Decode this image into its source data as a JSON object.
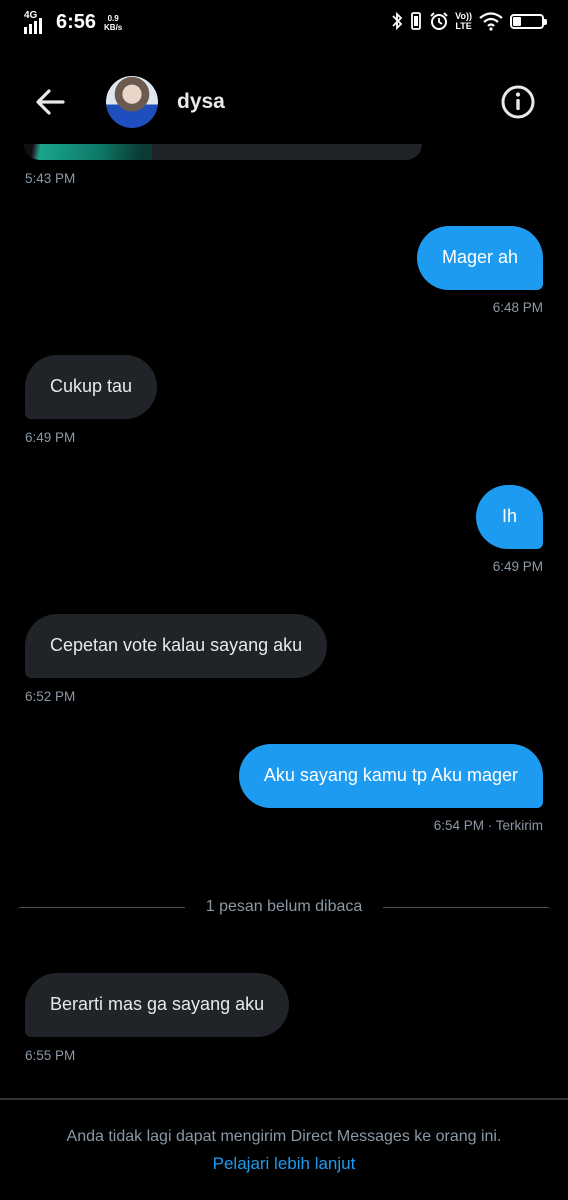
{
  "status_bar": {
    "network": "4G",
    "time": "6:56",
    "speed_value": "0.9",
    "speed_unit": "KB/s",
    "volte_top": "Vo))",
    "volte_bottom": "LTE",
    "battery": "30",
    "battery_level": 0.3
  },
  "header": {
    "contact_name": "dysa",
    "back_icon": "arrow-left-icon",
    "info_icon": "info-icon"
  },
  "conversation": {
    "previous_media_time": "5:43 PM",
    "messages": [
      {
        "direction": "out",
        "text": "Mager ah",
        "time": "6:48 PM"
      },
      {
        "direction": "in",
        "text": "Cukup tau",
        "time": "6:49 PM"
      },
      {
        "direction": "out",
        "text": "Ih",
        "time": "6:49 PM"
      },
      {
        "direction": "in",
        "text": "Cepetan vote kalau sayang aku",
        "time": "6:52 PM"
      },
      {
        "direction": "out",
        "text": "Aku sayang kamu tp Aku mager",
        "time": "6:54 PM · Terkirim"
      },
      {
        "direction": "in",
        "text": "Berarti mas ga sayang aku",
        "time": "6:55 PM"
      }
    ],
    "unread_divider": "1 pesan belum dibaca"
  },
  "footer": {
    "notice": "Anda tidak lagi dapat mengirim Direct Messages ke orang ini.",
    "learn_more": "Pelajari lebih lanjut"
  },
  "colors": {
    "accent": "#1d9bf0",
    "incoming_bubble": "#202327",
    "background": "#000000",
    "muted_text": "#8b98a5"
  }
}
